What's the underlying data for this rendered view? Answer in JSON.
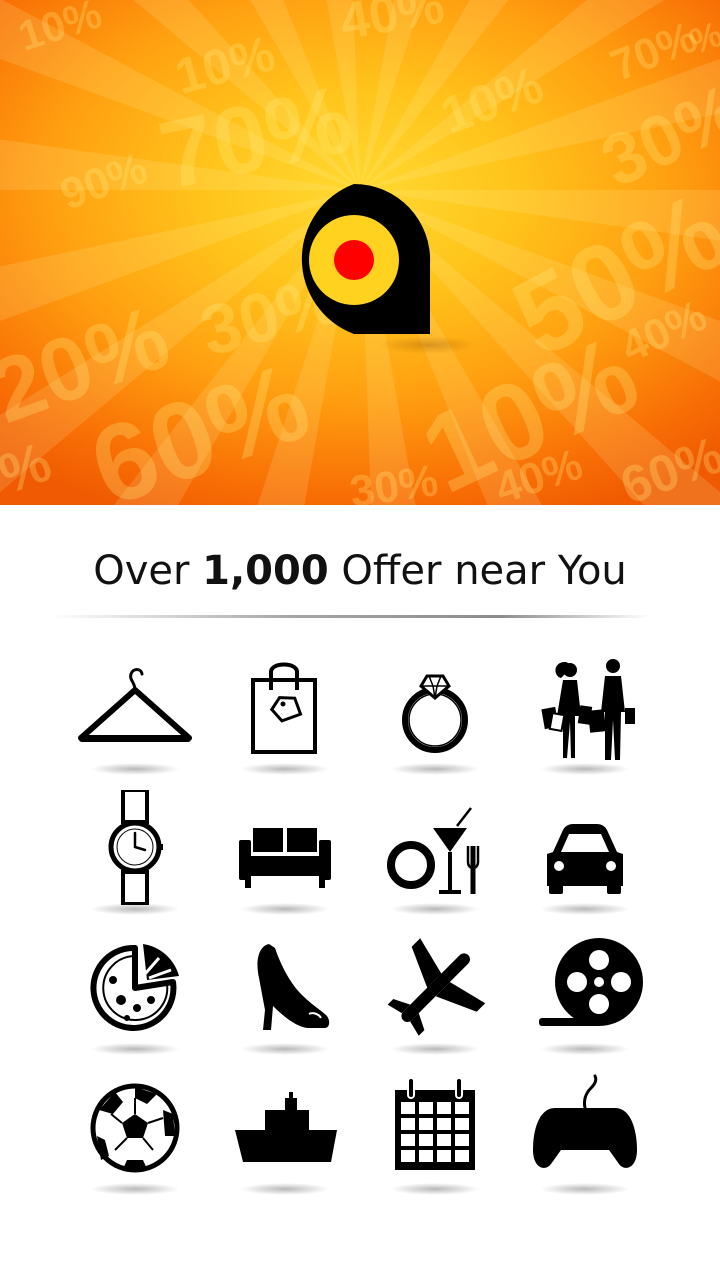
{
  "splash": {
    "background_colors": {
      "center": "#ffd932",
      "edge": "#ef5a02"
    },
    "background_percentages": [
      "10%",
      "70%",
      "40%",
      "90%",
      "10%",
      "30%",
      "70%",
      "10%",
      "50%",
      "20%",
      "30%",
      "40%",
      "60%",
      "10%",
      "%",
      "30%",
      "40%",
      "60%",
      "%"
    ],
    "logo": {
      "icon": "location-pin-logo-icon",
      "colors": {
        "ring": "#000000",
        "inner": "#ffd21f",
        "dot": "#ff0000"
      }
    }
  },
  "headline": {
    "prefix": "Over",
    "count": "1,000",
    "suffix": "Offer near You"
  },
  "categories": [
    {
      "icon": "clothes-hanger-icon"
    },
    {
      "icon": "shopping-bag-icon"
    },
    {
      "icon": "diamond-ring-icon"
    },
    {
      "icon": "shoppers-couple-icon"
    },
    {
      "icon": "wristwatch-icon"
    },
    {
      "icon": "sofa-icon"
    },
    {
      "icon": "dining-icon"
    },
    {
      "icon": "car-icon"
    },
    {
      "icon": "pizza-icon"
    },
    {
      "icon": "high-heel-shoe-icon"
    },
    {
      "icon": "airplane-icon"
    },
    {
      "icon": "film-reel-icon"
    },
    {
      "icon": "soccer-ball-icon"
    },
    {
      "icon": "ship-icon"
    },
    {
      "icon": "calendar-icon"
    },
    {
      "icon": "game-controller-icon"
    }
  ]
}
